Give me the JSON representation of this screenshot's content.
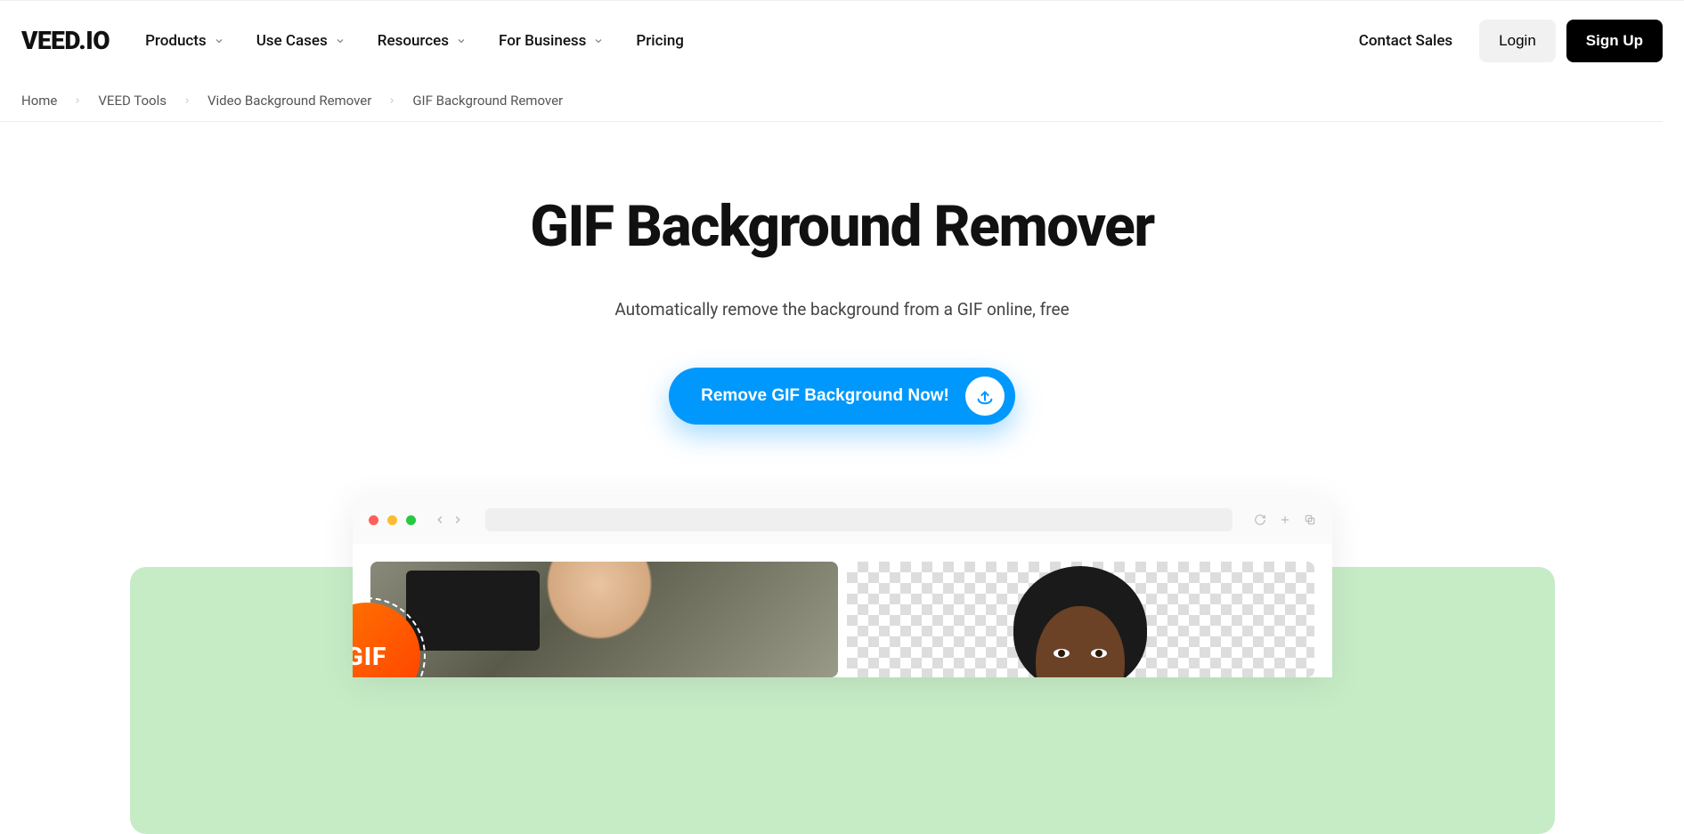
{
  "header": {
    "logo": "VEED.IO",
    "nav": {
      "products": "Products",
      "use_cases": "Use Cases",
      "resources": "Resources",
      "for_business": "For Business",
      "pricing": "Pricing"
    },
    "contact_sales": "Contact Sales",
    "login": "Login",
    "signup": "Sign Up"
  },
  "breadcrumb": {
    "items": [
      {
        "label": "Home"
      },
      {
        "label": "VEED Tools"
      },
      {
        "label": "Video Background Remover"
      },
      {
        "label": "GIF Background Remover"
      }
    ]
  },
  "hero": {
    "title": "GIF Background Remover",
    "subtitle": "Automatically remove the background from a GIF online, free",
    "cta_label": "Remove GIF Background Now!"
  },
  "preview": {
    "badge": "GIF"
  },
  "colors": {
    "accent": "#0098fd",
    "green_band": "#c6ecc6",
    "badge_gradient_start": "#ff7a00",
    "badge_gradient_end": "#ff3d00"
  }
}
